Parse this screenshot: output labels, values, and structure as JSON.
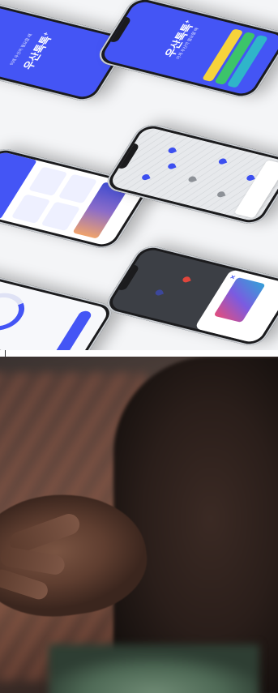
{
  "showcase": {
    "brand_name": "우산톡톡",
    "brand_plus": "+",
    "brand_tagline": "이제 우산이 필요할 때",
    "colors": {
      "primary": "#4455f5",
      "accent_yellow": "#f6d33b",
      "accent_green": "#3cc46a",
      "accent_teal": "#2fb5c9"
    },
    "phones": [
      {
        "screen": "splash-blue"
      },
      {
        "screen": "splash-blue-with-menu"
      },
      {
        "screen": "dashboard"
      },
      {
        "screen": "map"
      },
      {
        "screen": "balance"
      },
      {
        "screen": "payment-sheet"
      }
    ]
  },
  "photo": {
    "subject": "person-hands-holding-phone"
  }
}
